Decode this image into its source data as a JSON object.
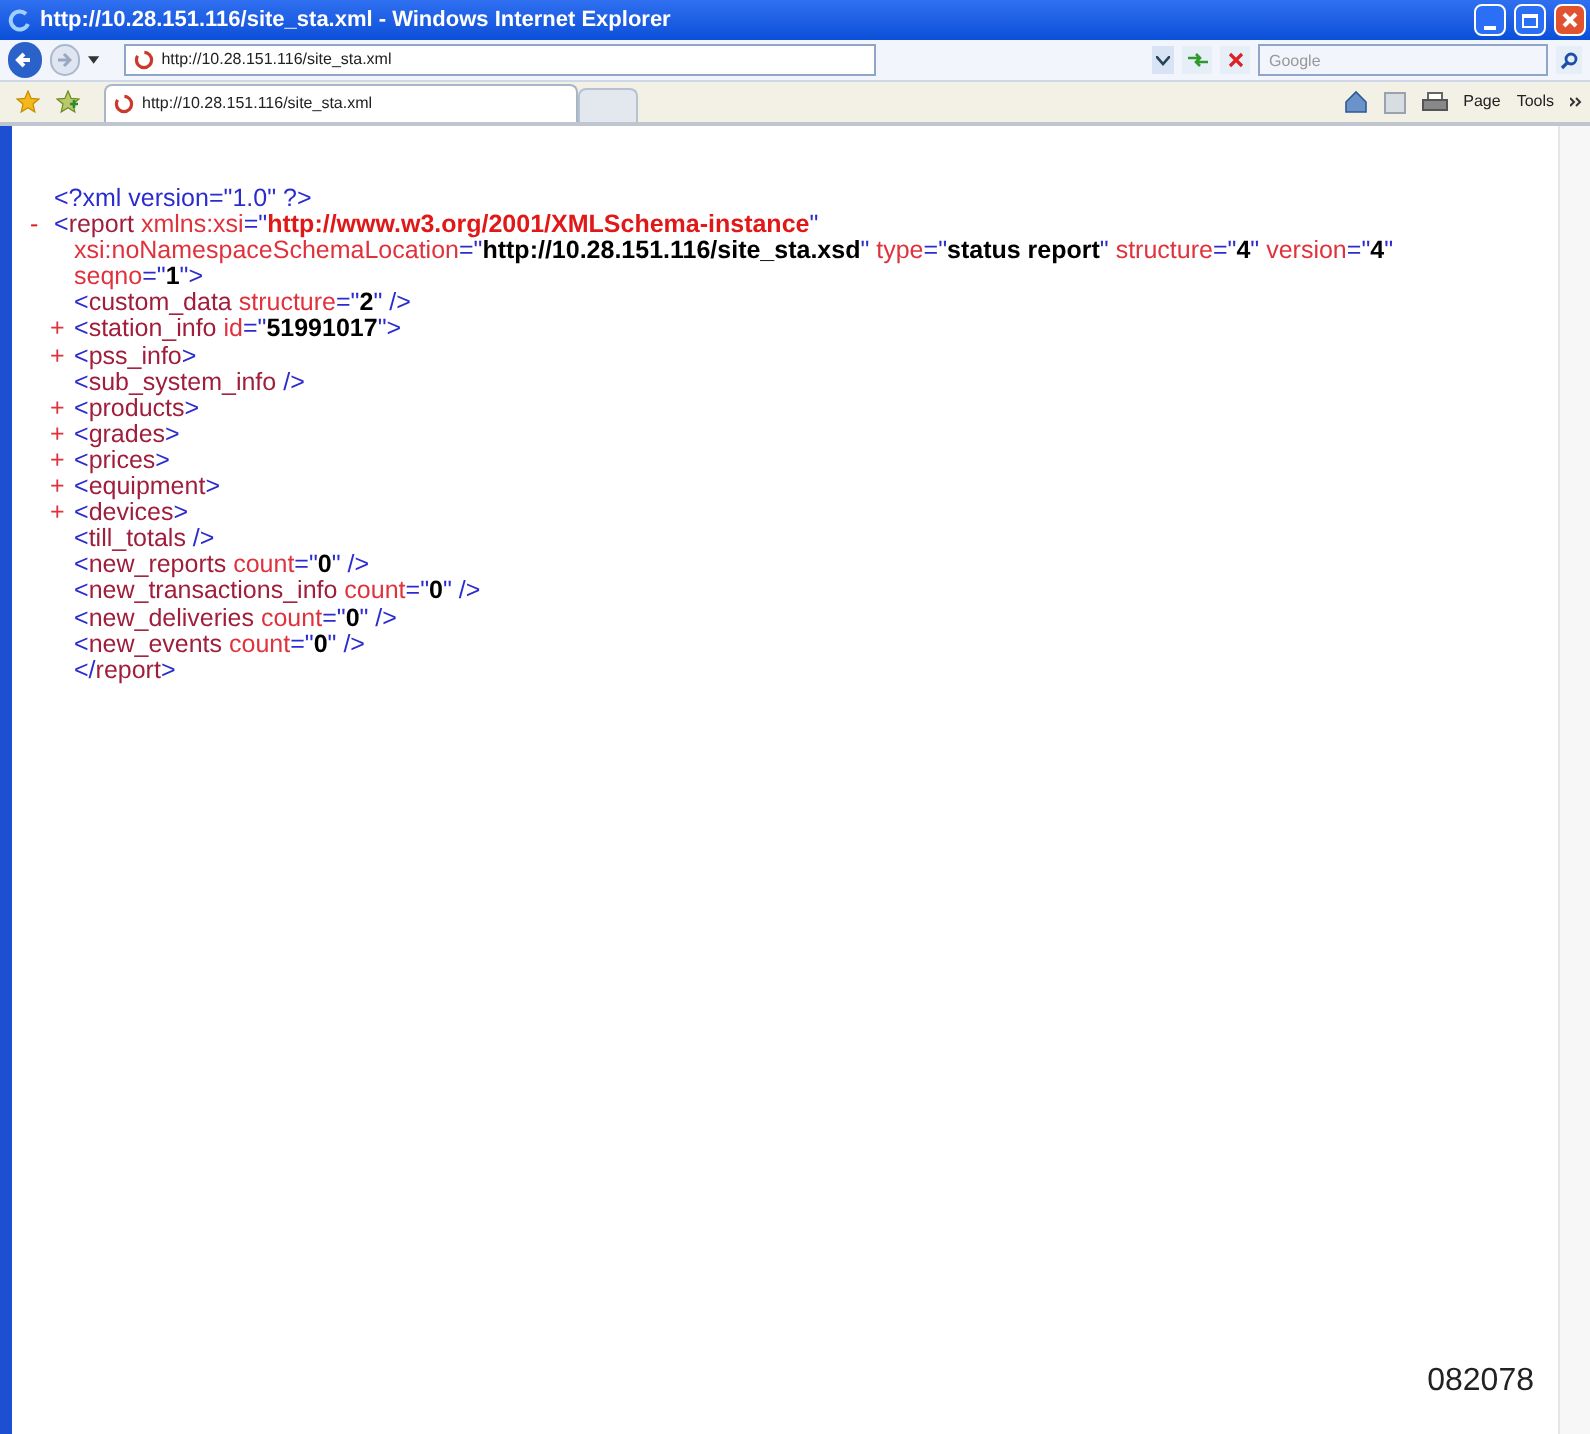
{
  "window": {
    "title": "http://10.28.151.116/site_sta.xml - Windows Internet Explorer"
  },
  "address_bar": {
    "url": "http://10.28.151.116/site_sta.xml",
    "search_placeholder": "Google"
  },
  "tabs": [
    {
      "label": "http://10.28.151.116/site_sta.xml",
      "selected": true
    },
    {
      "selected": false
    }
  ],
  "command_bar": {
    "page_label": "Page",
    "tools_label": "Tools"
  },
  "xml_tree": [
    {
      "lines": [
        [
          {
            "kind": "markup",
            "text": "<?xml version=\""
          },
          {
            "kind": "markup",
            "text": "1.0"
          },
          {
            "kind": "markup",
            "text": "\" ?>"
          }
        ]
      ]
    },
    {
      "expanded": true,
      "toggle": "-",
      "lines": [
        [
          {
            "kind": "markup",
            "text": "<"
          },
          {
            "kind": "name",
            "text": "report"
          },
          {
            "kind": "attr",
            "text": " xmlns:xsi"
          },
          {
            "kind": "markup",
            "text": "=\""
          },
          {
            "kind": "ns",
            "text": "http://www.w3.org/2001/XMLSchema-instance"
          },
          {
            "kind": "markup",
            "text": "\""
          }
        ],
        [
          {
            "kind": "attr",
            "text": "xsi:noNamespaceSchemaLocation"
          },
          {
            "kind": "markup",
            "text": "=\""
          },
          {
            "kind": "value",
            "text": "http://10.28.151.116/site_sta.xsd"
          },
          {
            "kind": "markup",
            "text": "\""
          },
          {
            "kind": "attr",
            "text": " type"
          },
          {
            "kind": "markup",
            "text": "=\""
          },
          {
            "kind": "value",
            "text": "status report"
          },
          {
            "kind": "markup",
            "text": "\""
          },
          {
            "kind": "attr",
            "text": " structure"
          },
          {
            "kind": "markup",
            "text": "=\""
          },
          {
            "kind": "value",
            "text": "4"
          },
          {
            "kind": "markup",
            "text": "\""
          },
          {
            "kind": "attr",
            "text": " version"
          },
          {
            "kind": "markup",
            "text": "=\""
          },
          {
            "kind": "value",
            "text": "4"
          },
          {
            "kind": "markup",
            "text": "\""
          }
        ],
        [
          {
            "kind": "attr",
            "text": "seqno"
          },
          {
            "kind": "markup",
            "text": "=\""
          },
          {
            "kind": "value",
            "text": "1"
          },
          {
            "kind": "markup",
            "text": "\">"
          }
        ]
      ],
      "children": [
        {
          "lines": [
            [
              {
                "kind": "markup",
                "text": "<"
              },
              {
                "kind": "name",
                "text": "custom_data"
              },
              {
                "kind": "attr",
                "text": " structure"
              },
              {
                "kind": "markup",
                "text": "=\""
              },
              {
                "kind": "value",
                "text": "2"
              },
              {
                "kind": "markup",
                "text": "\" />"
              }
            ]
          ]
        },
        {
          "expanded": false,
          "toggle": "+",
          "lines": [
            [
              {
                "kind": "markup",
                "text": "<"
              },
              {
                "kind": "name",
                "text": "station_info"
              },
              {
                "kind": "attr",
                "text": " id"
              },
              {
                "kind": "markup",
                "text": "=\""
              },
              {
                "kind": "value",
                "text": "51991017"
              },
              {
                "kind": "markup",
                "text": "\">"
              }
            ]
          ]
        },
        {
          "expanded": false,
          "toggle": "+",
          "lines": [
            [
              {
                "kind": "markup",
                "text": "<"
              },
              {
                "kind": "name",
                "text": "pss_info"
              },
              {
                "kind": "markup",
                "text": ">"
              }
            ]
          ]
        },
        {
          "lines": [
            [
              {
                "kind": "markup",
                "text": "<"
              },
              {
                "kind": "name",
                "text": "sub_system_info"
              },
              {
                "kind": "markup",
                "text": " />"
              }
            ]
          ]
        },
        {
          "expanded": false,
          "toggle": "+",
          "lines": [
            [
              {
                "kind": "markup",
                "text": "<"
              },
              {
                "kind": "name",
                "text": "products"
              },
              {
                "kind": "markup",
                "text": ">"
              }
            ]
          ]
        },
        {
          "expanded": false,
          "toggle": "+",
          "lines": [
            [
              {
                "kind": "markup",
                "text": "<"
              },
              {
                "kind": "name",
                "text": "grades"
              },
              {
                "kind": "markup",
                "text": ">"
              }
            ]
          ]
        },
        {
          "expanded": false,
          "toggle": "+",
          "lines": [
            [
              {
                "kind": "markup",
                "text": "<"
              },
              {
                "kind": "name",
                "text": "prices"
              },
              {
                "kind": "markup",
                "text": ">"
              }
            ]
          ]
        },
        {
          "expanded": false,
          "toggle": "+",
          "lines": [
            [
              {
                "kind": "markup",
                "text": "<"
              },
              {
                "kind": "name",
                "text": "equipment"
              },
              {
                "kind": "markup",
                "text": ">"
              }
            ]
          ]
        },
        {
          "expanded": false,
          "toggle": "+",
          "lines": [
            [
              {
                "kind": "markup",
                "text": "<"
              },
              {
                "kind": "name",
                "text": "devices"
              },
              {
                "kind": "markup",
                "text": ">"
              }
            ]
          ]
        },
        {
          "lines": [
            [
              {
                "kind": "markup",
                "text": "<"
              },
              {
                "kind": "name",
                "text": "till_totals"
              },
              {
                "kind": "markup",
                "text": " />"
              }
            ]
          ]
        },
        {
          "lines": [
            [
              {
                "kind": "markup",
                "text": "<"
              },
              {
                "kind": "name",
                "text": "new_reports"
              },
              {
                "kind": "attr",
                "text": " count"
              },
              {
                "kind": "markup",
                "text": "=\""
              },
              {
                "kind": "value",
                "text": "0"
              },
              {
                "kind": "markup",
                "text": "\" />"
              }
            ]
          ]
        },
        {
          "lines": [
            [
              {
                "kind": "markup",
                "text": "<"
              },
              {
                "kind": "name",
                "text": "new_transactions_info"
              },
              {
                "kind": "attr",
                "text": " count"
              },
              {
                "kind": "markup",
                "text": "=\""
              },
              {
                "kind": "value",
                "text": "0"
              },
              {
                "kind": "markup",
                "text": "\" />"
              }
            ]
          ]
        },
        {
          "lines": [
            [
              {
                "kind": "markup",
                "text": "<"
              },
              {
                "kind": "name",
                "text": "new_deliveries"
              },
              {
                "kind": "attr",
                "text": " count"
              },
              {
                "kind": "markup",
                "text": "=\""
              },
              {
                "kind": "value",
                "text": "0"
              },
              {
                "kind": "markup",
                "text": "\" />"
              }
            ]
          ]
        },
        {
          "lines": [
            [
              {
                "kind": "markup",
                "text": "<"
              },
              {
                "kind": "name",
                "text": "new_events"
              },
              {
                "kind": "attr",
                "text": " count"
              },
              {
                "kind": "markup",
                "text": "=\""
              },
              {
                "kind": "value",
                "text": "0"
              },
              {
                "kind": "markup",
                "text": "\" />"
              }
            ]
          ]
        }
      ],
      "close": [
        {
          "kind": "markup",
          "text": "</"
        },
        {
          "kind": "name",
          "text": "report"
        },
        {
          "kind": "markup",
          "text": ">"
        }
      ]
    }
  ],
  "figure_number": "082078"
}
